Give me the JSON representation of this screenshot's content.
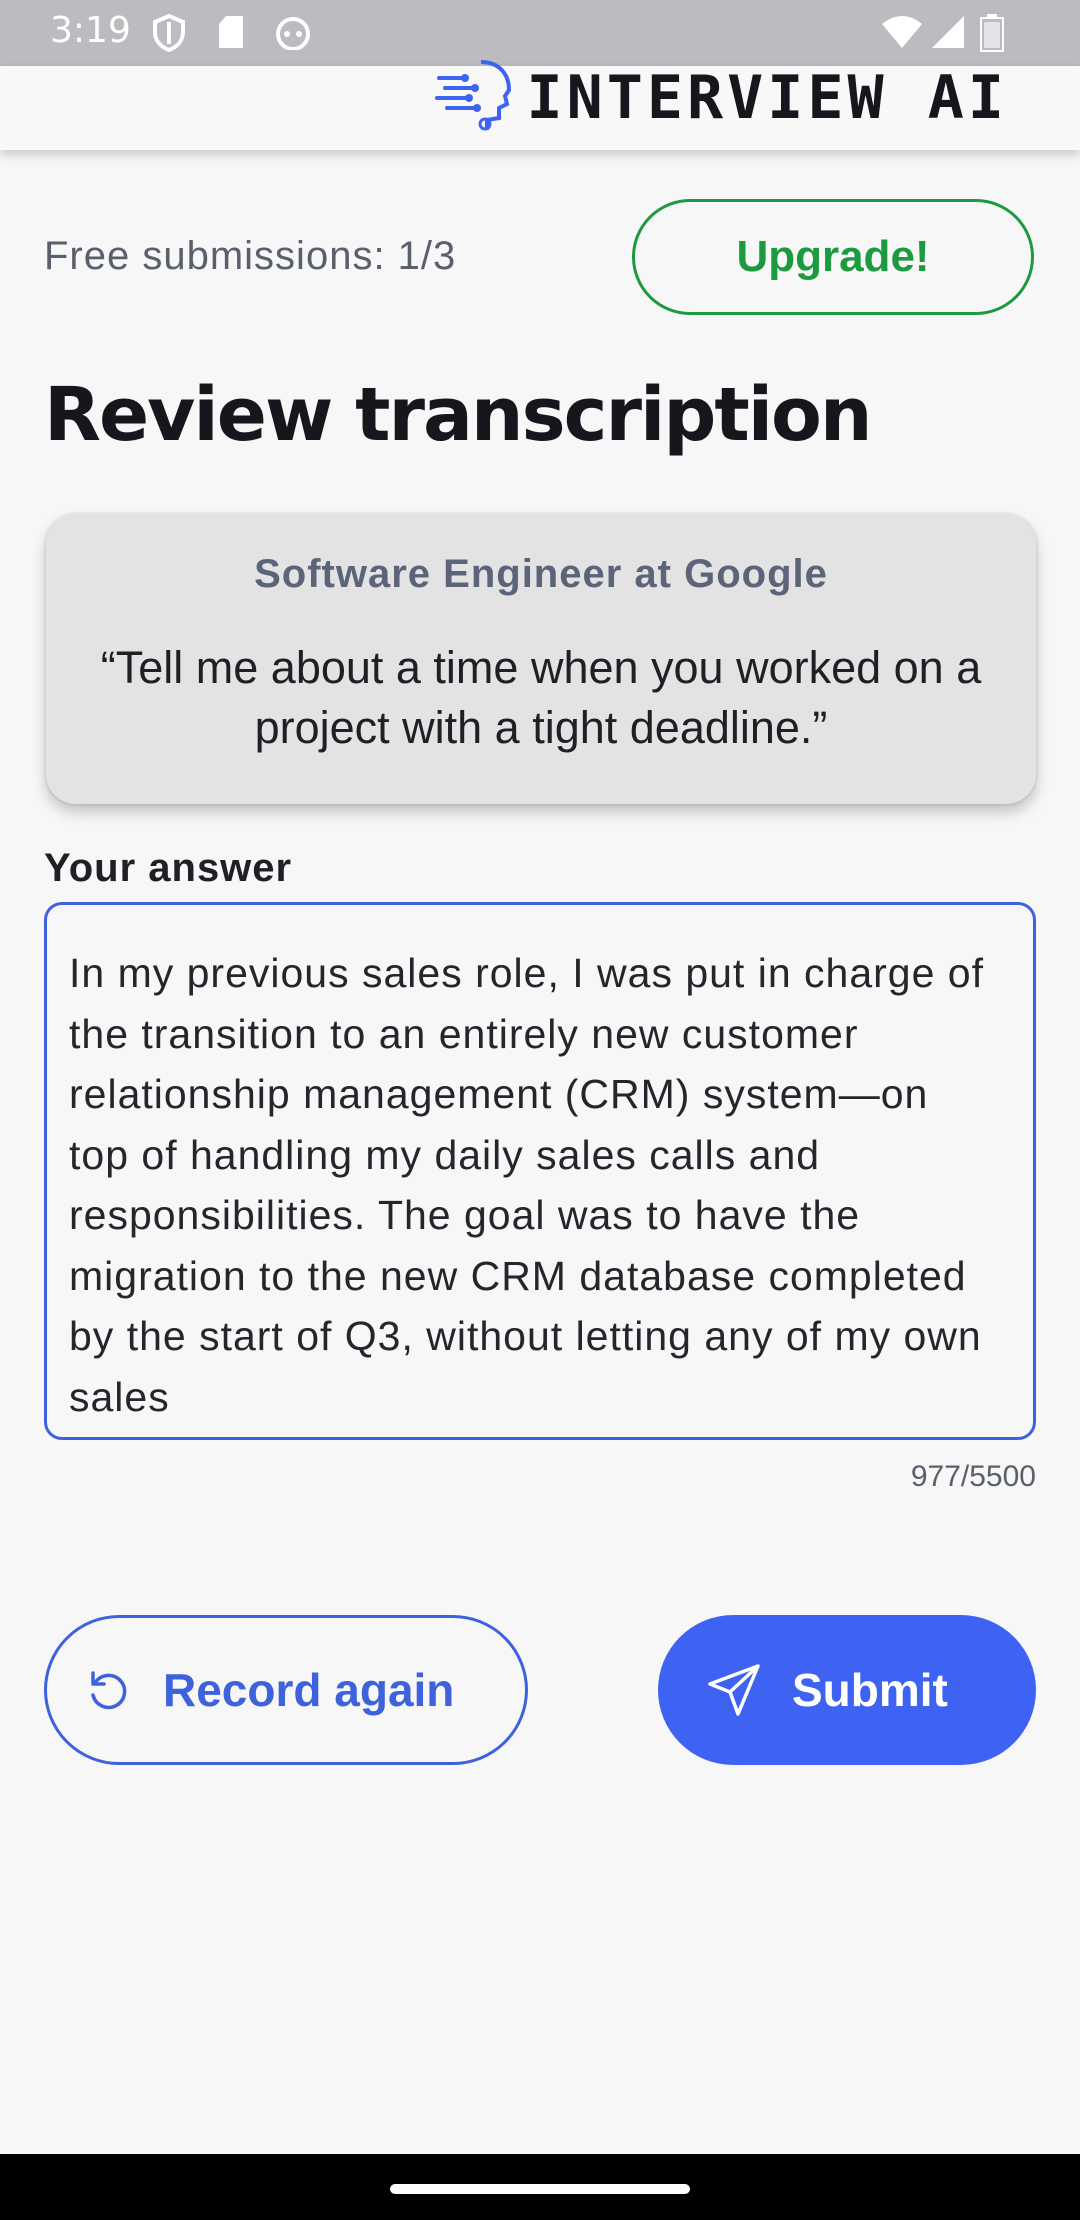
{
  "status_bar": {
    "time": "3:19",
    "icons": [
      "shield-icon",
      "sd-card-icon",
      "android-head-icon",
      "wifi-icon",
      "signal-icon",
      "battery-icon"
    ]
  },
  "app_bar": {
    "brand_name": "INTERVIEW AI",
    "logo_icon": "ai-head-circuit-icon"
  },
  "submissions": {
    "text": "Free submissions: 1/3",
    "upgrade_label": "Upgrade!"
  },
  "page_title": "Review transcription",
  "question_card": {
    "role": "Software Engineer at Google",
    "question": "“Tell me about a time when you worked on a project with a tight deadline.”"
  },
  "answer": {
    "label": "Your answer",
    "value": "In my previous sales role, I was put in charge of the transition to an entirely new customer relationship management (CRM) system—on top of handling my daily sales calls and responsibilities. The goal was to have the migration to the new CRM database completed by the start of Q3, without letting any of my own sales",
    "counter": "977/5500"
  },
  "actions": {
    "record_label": "Record again",
    "submit_label": "Submit"
  },
  "colors": {
    "accent_blue": "#3e63f2",
    "upgrade_green": "#1c9a3f",
    "background": "#f7f7f8",
    "card": "#e3e3e4"
  }
}
